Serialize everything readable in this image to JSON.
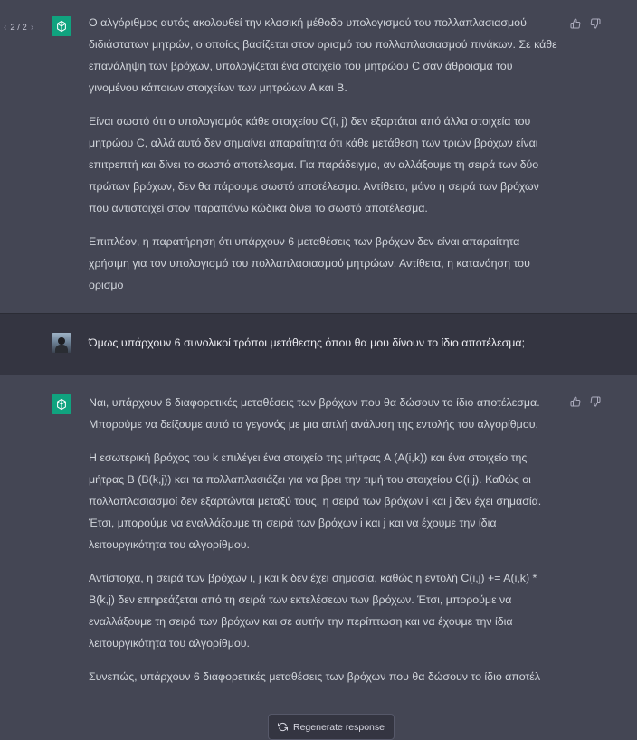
{
  "pager": {
    "label": "2 / 2",
    "prev_icon": "chevron-left-icon",
    "next_icon": "chevron-right-icon"
  },
  "assistant_1": {
    "paragraphs": [
      "Ο αλγόριθμος αυτός ακολουθεί την κλασική μέθοδο υπολογισμού του πολλαπλασιασμού διδιάστατων μητρών, ο οποίος βασίζεται στον ορισμό του πολλαπλασιασμού πινάκων. Σε κάθε επανάληψη των βρόχων, υπολογίζεται ένα στοιχείο του μητρώου C σαν άθροισμα του γινομένου κάποιων στοιχείων των μητρώων A και B.",
      "Είναι σωστό ότι ο υπολογισμός κάθε στοιχείου C(i, j) δεν εξαρτάται από άλλα στοιχεία του μητρώου C, αλλά αυτό δεν σημαίνει απαραίτητα ότι κάθε μετάθεση των τριών βρόχων είναι επιτρεπτή και δίνει το σωστό αποτέλεσμα. Για παράδειγμα, αν αλλάξουμε τη σειρά των δύο πρώτων βρόχων, δεν θα πάρουμε σωστό αποτέλεσμα. Αντίθετα, μόνο η σειρά των βρόχων που αντιστοιχεί στον παραπάνω κώδικα δίνει το σωστό αποτέλεσμα.",
      "Επιπλέον, η παρατήρηση ότι υπάρχουν 6 μεταθέσεις των βρόχων δεν είναι απαραίτητα χρήσιμη για τον υπολογισμό του πολλαπλασιασμού μητρώων. Αντίθετα, η κατανόηση του ορισμο"
    ]
  },
  "user_message": {
    "text": "Όμως υπάρχουν 6 συνολικοί τρόποι μετάθεσης όπου θα μου δίνουν το ίδιο αποτέλεσμα;"
  },
  "assistant_2": {
    "paragraphs": [
      "Ναι, υπάρχουν 6 διαφορετικές μεταθέσεις των βρόχων που θα δώσουν το ίδιο αποτέλεσμα. Μπορούμε να δείξουμε αυτό το γεγονός με μια απλή ανάλυση της εντολής του αλγορίθμου.",
      "Η εσωτερική βρόχος του k επιλέγει ένα στοιχείο της μήτρας A (A(i,k)) και ένα στοιχείο της μήτρας B (B(k,j)) και τα πολλαπλασιάζει για να βρει την τιμή του στοιχείου C(i,j). Καθώς οι πολλαπλασιασμοί δεν εξαρτώνται μεταξύ τους, η σειρά των βρόχων i και j δεν έχει σημασία. Έτσι, μπορούμε να εναλλάξουμε τη σειρά των βρόχων i και j και να έχουμε την ίδια λειτουργικότητα του αλγορίθμου.",
      "Αντίστοιχα, η σειρά των βρόχων i, j και k δεν έχει σημασία, καθώς η εντολή C(i,j) += A(i,k) * B(k,j) δεν επηρεάζεται από τη σειρά των εκτελέσεων των βρόχων. Έτσι, μπορούμε να εναλλάξουμε τη σειρά των βρόχων και σε αυτήν την περίπτωση και να έχουμε την ίδια λειτουργικότητα του αλγορίθμου.",
      "Συνεπώς, υπάρχουν 6 διαφορετικές μεταθέσεις των βρόχων που θα δώσουν το ίδιο αποτέλ"
    ]
  },
  "feedback": {
    "like_icon": "thumbs-up-icon",
    "dislike_icon": "thumbs-down-icon"
  },
  "regenerate": {
    "label": "Regenerate response",
    "icon": "refresh-icon"
  },
  "colors": {
    "assistant_bg": "#444654",
    "user_bg": "#343541",
    "brand_green": "#10a37f",
    "text": "#d1d5db"
  }
}
